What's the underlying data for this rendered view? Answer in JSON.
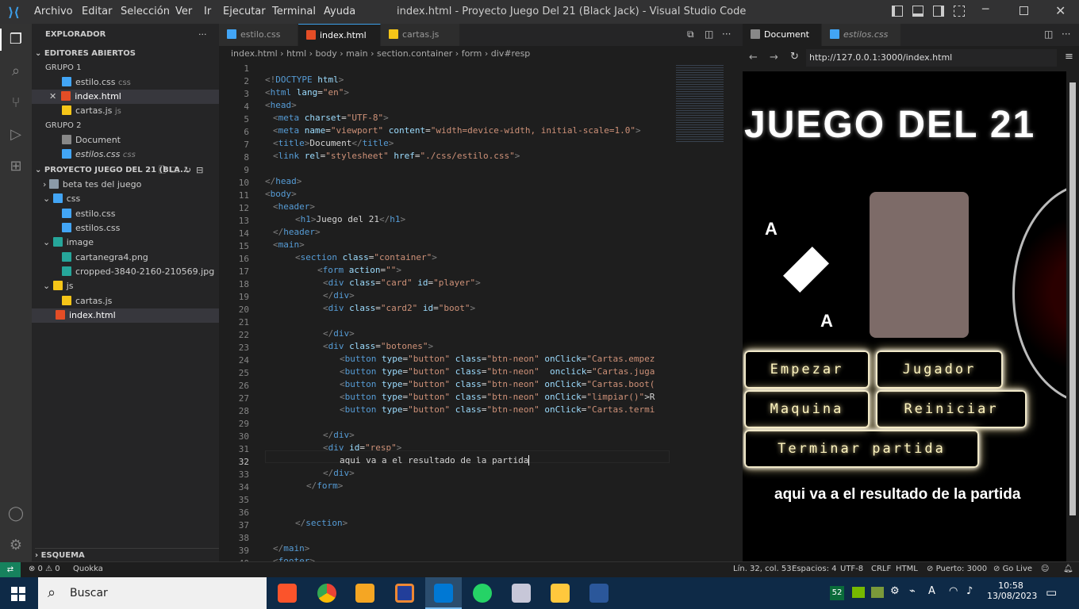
{
  "titlebar": {
    "menus": [
      "Archivo",
      "Editar",
      "Selección",
      "Ver",
      "Ir",
      "Ejecutar",
      "Terminal",
      "Ayuda"
    ],
    "title": "index.html - Proyecto Juego Del 21 (Black Jack) - Visual Studio Code"
  },
  "sidebar": {
    "header": "EXPLORADOR",
    "open_editors": "EDITORES ABIERTOS",
    "group1": "GRUPO 1",
    "group1_items": [
      {
        "name": "estilo.css",
        "suffix": "css"
      },
      {
        "name": "index.html",
        "suffix": ""
      },
      {
        "name": "cartas.js",
        "suffix": "js"
      }
    ],
    "group2": "GRUPO 2",
    "group2_items": [
      {
        "name": "Document",
        "suffix": ""
      },
      {
        "name": "estilos.css",
        "suffix": "css"
      }
    ],
    "project": "PROYECTO JUEGO DEL 21 (BLA...",
    "tree": [
      {
        "name": "beta tes del juego",
        "indent": 1
      },
      {
        "name": "css",
        "indent": 1
      },
      {
        "name": "estilo.css",
        "indent": 2
      },
      {
        "name": "estilos.css",
        "indent": 2
      },
      {
        "name": "image",
        "indent": 1
      },
      {
        "name": "cartanegra4.png",
        "indent": 2
      },
      {
        "name": "cropped-3840-2160-210569.jpg",
        "indent": 2
      },
      {
        "name": "js",
        "indent": 1
      },
      {
        "name": "cartas.js",
        "indent": 2
      },
      {
        "name": "index.html",
        "indent": 1
      }
    ],
    "outline": "ESQUEMA"
  },
  "editor": {
    "tabs": [
      "estilo.css",
      "index.html",
      "cartas.js"
    ],
    "breadcrumb": [
      "index.html",
      "html",
      "body",
      "main",
      "section.container",
      "form",
      "div#resp"
    ]
  },
  "browser": {
    "tabs": [
      "Document",
      "estilos.css"
    ],
    "url": "http://127.0.0.1:3000/index.html",
    "page_title": "JUEGO DEL 21",
    "card_rank": "A",
    "buttons": [
      "Empezar",
      "Jugador",
      "Maquina",
      "Reiniciar",
      "Terminar partida"
    ],
    "result": "aqui va a el resultado de la partida"
  },
  "status": {
    "left": "⊗ 0 ⚠ 0",
    "quokka": "Quokka",
    "position": "Lín. 32, col. 53",
    "spaces": "Espacios: 4",
    "encoding": "UTF-8",
    "eol": "CRLF",
    "lang": "HTML",
    "port": "Puerto: 3000",
    "golive": "Go Live"
  },
  "taskbar": {
    "search": "Buscar",
    "temp": "52",
    "time": "10:58",
    "date": "13/08/2023"
  }
}
